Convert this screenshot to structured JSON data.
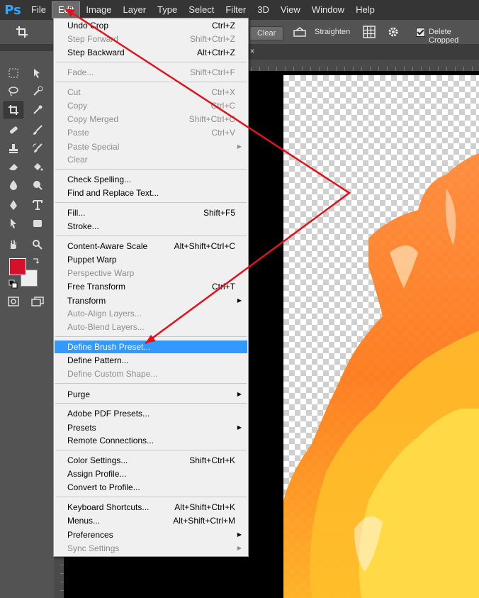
{
  "app": {
    "logo": "Ps",
    "menubar": [
      "File",
      "Edit",
      "Image",
      "Layer",
      "Type",
      "Select",
      "Filter",
      "3D",
      "View",
      "Window",
      "Help"
    ]
  },
  "options": {
    "clear": "Clear",
    "straighten": "Straighten",
    "delete_cropped": "Delete Cropped"
  },
  "colors": {
    "foreground": "#d4102a",
    "background": "#eeeeee",
    "highlight": "#3399ff"
  },
  "edit_menu": {
    "items": [
      {
        "label": "Undo Crop",
        "shortcut": "Ctrl+Z",
        "state": "enabled"
      },
      {
        "label": "Step Forward",
        "shortcut": "Shift+Ctrl+Z",
        "state": "disabled"
      },
      {
        "label": "Step Backward",
        "shortcut": "Alt+Ctrl+Z",
        "state": "enabled"
      },
      {
        "label": "Fade...",
        "shortcut": "Shift+Ctrl+F",
        "state": "disabled"
      },
      {
        "label": "Cut",
        "shortcut": "Ctrl+X",
        "state": "disabled"
      },
      {
        "label": "Copy",
        "shortcut": "Ctrl+C",
        "state": "disabled"
      },
      {
        "label": "Copy Merged",
        "shortcut": "Shift+Ctrl+C",
        "state": "disabled"
      },
      {
        "label": "Paste",
        "shortcut": "Ctrl+V",
        "state": "disabled"
      },
      {
        "label": "Paste Special",
        "shortcut": "",
        "state": "disabled",
        "submenu": true
      },
      {
        "label": "Clear",
        "shortcut": "",
        "state": "disabled"
      },
      {
        "label": "Check Spelling...",
        "shortcut": "",
        "state": "enabled"
      },
      {
        "label": "Find and Replace Text...",
        "shortcut": "",
        "state": "enabled"
      },
      {
        "label": "Fill...",
        "shortcut": "Shift+F5",
        "state": "enabled"
      },
      {
        "label": "Stroke...",
        "shortcut": "",
        "state": "enabled"
      },
      {
        "label": "Content-Aware Scale",
        "shortcut": "Alt+Shift+Ctrl+C",
        "state": "enabled"
      },
      {
        "label": "Puppet Warp",
        "shortcut": "",
        "state": "enabled"
      },
      {
        "label": "Perspective Warp",
        "shortcut": "",
        "state": "disabled"
      },
      {
        "label": "Free Transform",
        "shortcut": "Ctrl+T",
        "state": "enabled"
      },
      {
        "label": "Transform",
        "shortcut": "",
        "state": "enabled",
        "submenu": true
      },
      {
        "label": "Auto-Align Layers...",
        "shortcut": "",
        "state": "disabled"
      },
      {
        "label": "Auto-Blend Layers...",
        "shortcut": "",
        "state": "disabled"
      },
      {
        "label": "Define Brush Preset...",
        "shortcut": "",
        "state": "highlighted"
      },
      {
        "label": "Define Pattern...",
        "shortcut": "",
        "state": "enabled"
      },
      {
        "label": "Define Custom Shape...",
        "shortcut": "",
        "state": "disabled"
      },
      {
        "label": "Purge",
        "shortcut": "",
        "state": "enabled",
        "submenu": true
      },
      {
        "label": "Adobe PDF Presets...",
        "shortcut": "",
        "state": "enabled"
      },
      {
        "label": "Presets",
        "shortcut": "",
        "state": "enabled",
        "submenu": true
      },
      {
        "label": "Remote Connections...",
        "shortcut": "",
        "state": "enabled"
      },
      {
        "label": "Color Settings...",
        "shortcut": "Shift+Ctrl+K",
        "state": "enabled"
      },
      {
        "label": "Assign Profile...",
        "shortcut": "",
        "state": "enabled"
      },
      {
        "label": "Convert to Profile...",
        "shortcut": "",
        "state": "enabled"
      },
      {
        "label": "Keyboard Shortcuts...",
        "shortcut": "Alt+Shift+Ctrl+K",
        "state": "enabled"
      },
      {
        "label": "Menus...",
        "shortcut": "Alt+Shift+Ctrl+M",
        "state": "enabled"
      },
      {
        "label": "Preferences",
        "shortcut": "",
        "state": "enabled",
        "submenu": true
      },
      {
        "label": "Sync Settings",
        "shortcut": "",
        "state": "disabled",
        "submenu": true
      }
    ]
  }
}
